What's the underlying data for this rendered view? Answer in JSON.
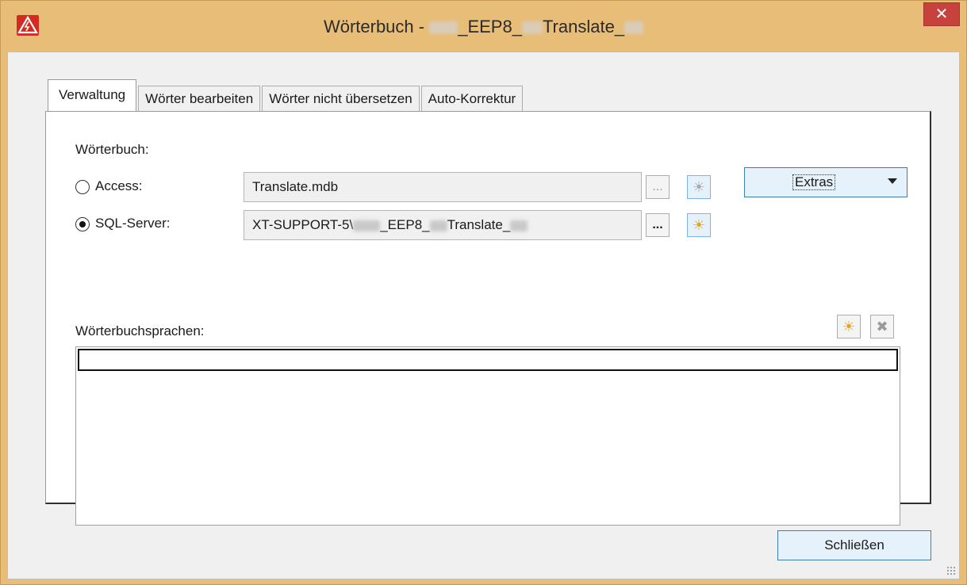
{
  "window": {
    "title_prefix": "Wörterbuch - ",
    "title_mid": "_EEP8_",
    "title_suffix": "Translate_",
    "close_glyph": "✕"
  },
  "tabs": [
    {
      "label": "Verwaltung",
      "active": true
    },
    {
      "label": "Wörter bearbeiten",
      "active": false
    },
    {
      "label": "Wörter nicht übersetzen",
      "active": false
    },
    {
      "label": "Auto-Korrektur",
      "active": false
    }
  ],
  "dictionary": {
    "section_label": "Wörterbuch:",
    "access": {
      "label": "Access:",
      "selected": false,
      "value": "Translate.mdb",
      "browse_label": "...",
      "new_icon": "sun-icon"
    },
    "sql": {
      "label": "SQL-Server:",
      "selected": true,
      "value_prefix": "XT-SUPPORT-5\\",
      "value_mid": "_EEP8_",
      "value_suffix": "Translate_",
      "browse_label": "...",
      "new_icon": "sun-icon"
    },
    "extras_label": "Extras"
  },
  "languages": {
    "label": "Wörterbuchsprachen:",
    "add_icon": "sun-icon",
    "delete_glyph": "✖",
    "items": []
  },
  "footer": {
    "close_label": "Schließen"
  },
  "colors": {
    "accent": "#3c7fb1",
    "frame": "#e8bd77",
    "close": "#c7413d",
    "icon_orange": "#e8a317"
  }
}
